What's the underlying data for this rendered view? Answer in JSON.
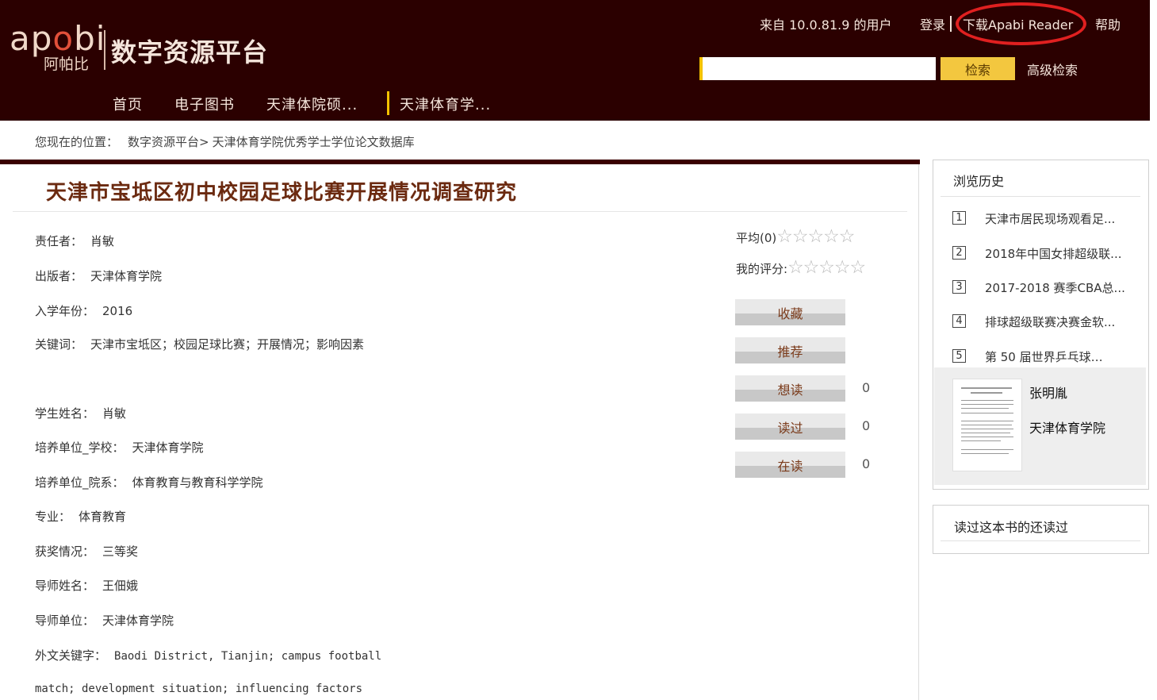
{
  "header": {
    "logo_word_a": "ap",
    "logo_word_o": "o",
    "logo_word_b": "bi",
    "logo_sub": "阿帕比",
    "platform_title": "数字资源平台",
    "user_info": "来自 10.0.81.9 的用户",
    "login": "登录",
    "download_reader": "下载Apabi Reader",
    "help": "帮助",
    "search_placeholder": "",
    "search_button": "检索",
    "advanced_search": "高级检索",
    "nav": [
      "首页",
      "电子图书",
      "天津体院硕...",
      "天津体育学..."
    ]
  },
  "breadcrumb": {
    "label": "您现在的位置：",
    "items": [
      "数字资源平台>",
      "天津体育学院优秀学士学位论文数据库"
    ]
  },
  "book": {
    "title": "天津市宝坻区初中校园足球比赛开展情况调查研究",
    "fields": [
      {
        "k": "责任者：",
        "v": "肖敏"
      },
      {
        "k": "出版者：",
        "v": "天津体育学院"
      },
      {
        "k": "入学年份：",
        "v": "2016"
      },
      {
        "k": "关键词：",
        "v": "天津市宝坻区；校园足球比赛；开展情况；影响因素"
      },
      {
        "k": "学生姓名：",
        "v": "肖敏"
      },
      {
        "k": "培养单位_学校：",
        "v": "天津体育学院"
      },
      {
        "k": "培养单位_院系：",
        "v": "体育教育与教育科学学院"
      },
      {
        "k": "专业：",
        "v": "体育教育"
      },
      {
        "k": "获奖情况：",
        "v": "三等奖"
      },
      {
        "k": "导师姓名：",
        "v": "王佃娥"
      },
      {
        "k": "导师单位：",
        "v": "天津体育学院"
      },
      {
        "k": "外文关键字：",
        "v": "Baodi District, Tianjin; campus football"
      }
    ],
    "foreign_keywords_cont": "match; development situation; influencing factors"
  },
  "rating": {
    "avg_label": "平均(0)",
    "my_label": "我的评分:",
    "stars": "☆☆☆☆☆"
  },
  "actions": [
    {
      "label": "收藏",
      "count": ""
    },
    {
      "label": "推荐",
      "count": ""
    },
    {
      "label": "想读",
      "count": "0"
    },
    {
      "label": "读过",
      "count": "0"
    },
    {
      "label": "在读",
      "count": "0"
    }
  ],
  "sidebar": {
    "history_title": "浏览历史",
    "history": [
      {
        "num": "1",
        "title": "天津市居民现场观看足..."
      },
      {
        "num": "2",
        "title": "2018年中国女排超级联..."
      },
      {
        "num": "3",
        "title": "2017-2018 赛季CBA总..."
      },
      {
        "num": "4",
        "title": "排球超级联赛决赛金软..."
      },
      {
        "num": "5",
        "title": "第 50 届世界乒乓球…"
      }
    ],
    "preview_author": "张明胤",
    "preview_publisher": "天津体育学院",
    "also_read_title": "读过这本书的还读过"
  },
  "colors": {
    "header_bg": "#2b0000",
    "search_button": "#f3c73f",
    "title_color": "#6b2a10",
    "highlight_circle": "#e02020"
  }
}
